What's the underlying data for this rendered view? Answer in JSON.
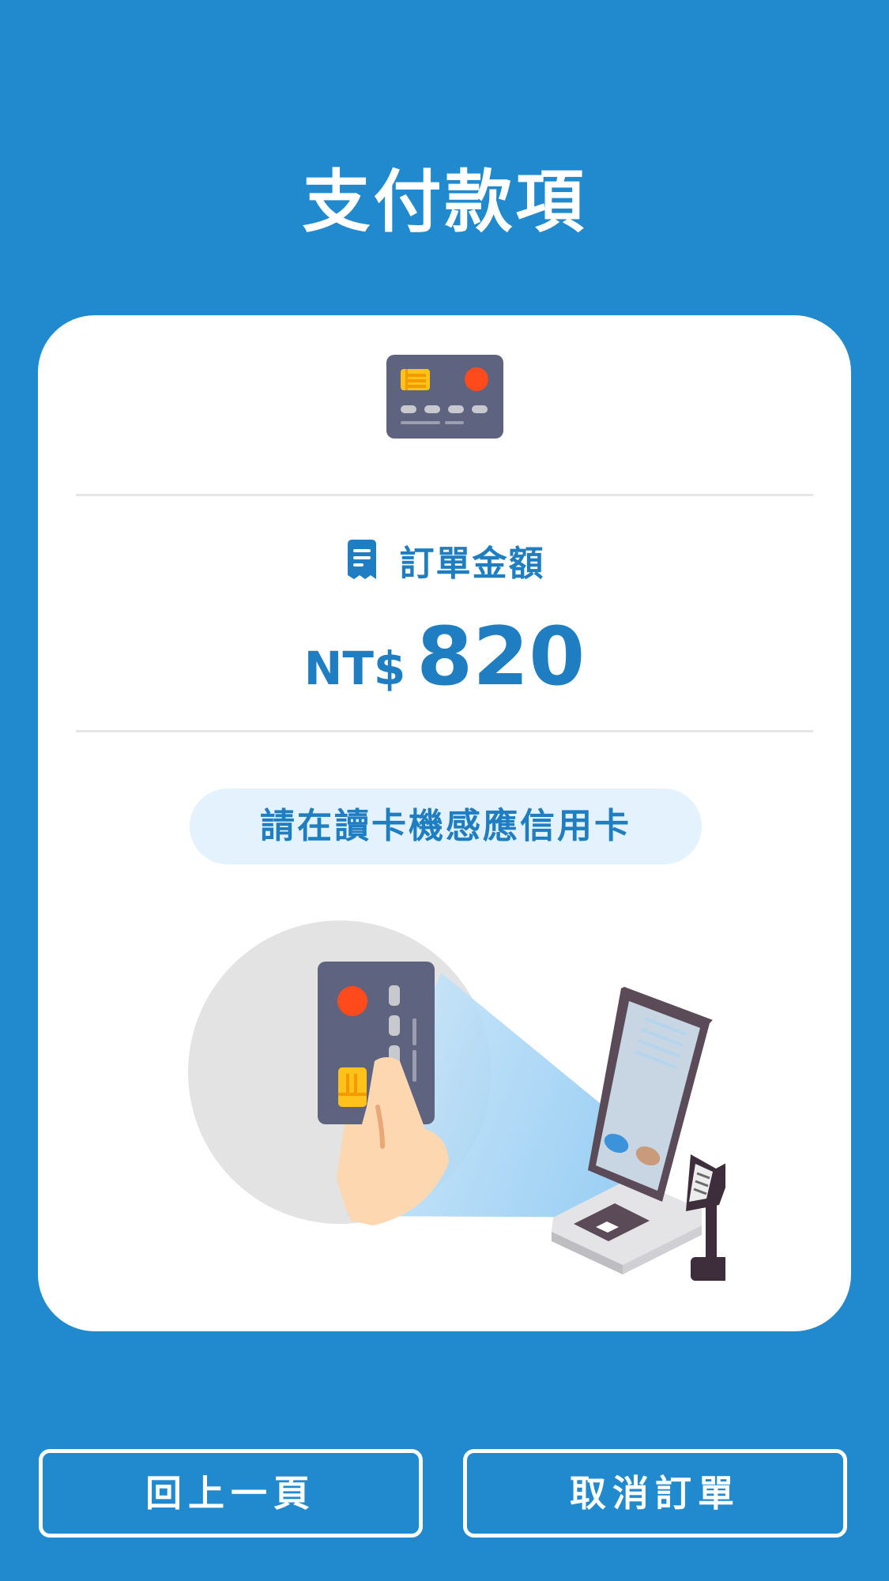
{
  "header": {
    "title": "支付款項"
  },
  "order": {
    "label": "訂單金額",
    "currency": "NT$",
    "amount": "820"
  },
  "instruction": "請在讀卡機感應信用卡",
  "buttons": {
    "back_label": "回上一頁",
    "cancel_label": "取消訂單"
  },
  "icons": {
    "payment_method": "credit-card-icon",
    "amount": "receipt-icon",
    "illustration": "card-reader-tap-illustration"
  },
  "colors": {
    "background": "#218ACF",
    "card": "#FFFFFF",
    "accent_text": "#1F7DC1",
    "pill_background": "#E3F2FC",
    "divider": "#E6E6E6"
  }
}
